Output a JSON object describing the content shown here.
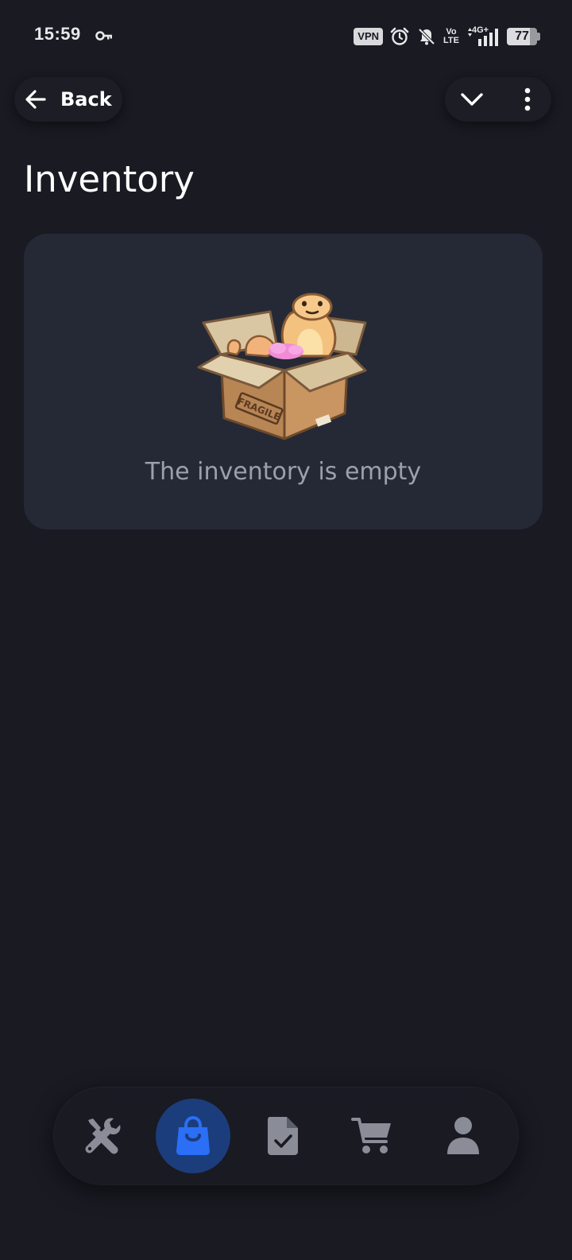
{
  "status_bar": {
    "time": "15:59",
    "vpn_label": "VPN",
    "volte_top": "Vo",
    "volte_bottom": "LTE",
    "network_label": "4G+",
    "battery_level": "77",
    "battery_fraction": 0.77,
    "icons": [
      "key-icon",
      "alarm-icon",
      "bell-off-icon",
      "signal-icon",
      "battery-icon"
    ]
  },
  "header": {
    "back_label": "Back",
    "back_icon": "arrow-left-icon",
    "actions": [
      "chevron-down-icon",
      "more-vertical-icon"
    ]
  },
  "page": {
    "title": "Inventory"
  },
  "empty_state": {
    "illustration": "snake-in-box-illustration",
    "box_label": "FRAGILE",
    "message": "The inventory is empty"
  },
  "bottom_nav": {
    "items": [
      {
        "icon": "tools-icon",
        "active": false
      },
      {
        "icon": "shopping-bag-icon",
        "active": true
      },
      {
        "icon": "document-check-icon",
        "active": false
      },
      {
        "icon": "cart-icon",
        "active": false
      },
      {
        "icon": "user-icon",
        "active": false
      }
    ]
  },
  "colors": {
    "background": "#191a22",
    "card": "#252935",
    "accent": "#2a6ff5",
    "active_nav_bg": "#1c3d7c",
    "muted_text": "#9ca0ad",
    "nav_icon": "#8a8d97"
  }
}
